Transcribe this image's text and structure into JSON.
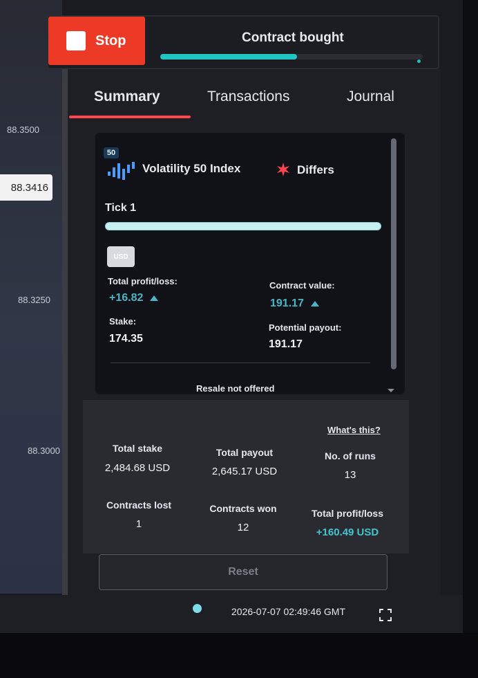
{
  "colors": {
    "stop_button": "#ec3a27",
    "accent_teal": "#1fc6c4",
    "tab_underline": "#ff444f",
    "profit_green": "#4bb4c6"
  },
  "chart": {
    "price_labels": [
      "88.3500",
      "88.3250",
      "88.3000"
    ],
    "current_price": "88.3416"
  },
  "header": {
    "stop_label": "Stop",
    "status": "Contract bought",
    "progress_fraction": 0.52
  },
  "tabs": [
    {
      "label": "Summary",
      "active": true
    },
    {
      "label": "Transactions",
      "active": false
    },
    {
      "label": "Journal",
      "active": false
    }
  ],
  "contract": {
    "badge": "50",
    "market": "Volatility 50 Index",
    "trade_type": "Differs",
    "tick_label": "Tick 1",
    "currency_chip": "USD",
    "total_pl_label": "Total profit/loss:",
    "total_pl_value": "+16.82",
    "contract_value_label": "Contract value:",
    "contract_value": "191.17",
    "stake_label": "Stake:",
    "stake_value": "174.35",
    "potential_payout_label": "Potential payout:",
    "potential_payout_value": "191.17",
    "resale_note": "Resale not offered"
  },
  "stats": {
    "whats_this": "What's this?",
    "total_stake_label": "Total stake",
    "total_stake": "2,484.68 USD",
    "total_payout_label": "Total payout",
    "total_payout": "2,645.17 USD",
    "runs_label": "No. of runs",
    "runs": "13",
    "lost_label": "Contracts lost",
    "lost": "1",
    "won_label": "Contracts won",
    "won": "12",
    "total_pl_label": "Total profit/loss",
    "total_pl": "+160.49 USD",
    "reset_label": "Reset"
  },
  "footer": {
    "timestamp": "2026-07-07 02:49:46 GMT"
  }
}
